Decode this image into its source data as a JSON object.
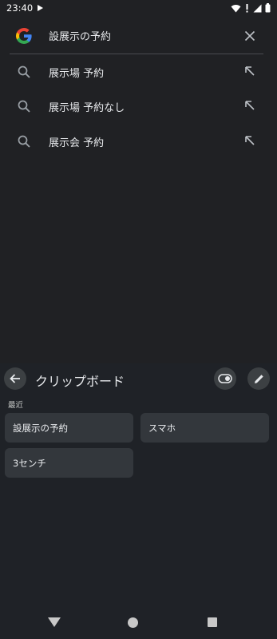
{
  "status_bar": {
    "time": "23:40"
  },
  "search": {
    "query": "設展示の予約",
    "suggestions": [
      {
        "text": "展示場 予約"
      },
      {
        "text": "展示場 予約なし"
      },
      {
        "text": "展示会 予約"
      }
    ]
  },
  "clipboard": {
    "title": "クリップボード",
    "section_label": "最近",
    "items": [
      {
        "text": "設展示の予約"
      },
      {
        "text": "スマホ"
      },
      {
        "text": "3センチ"
      }
    ]
  },
  "colors": {
    "background": "#202124",
    "keyboard_bg": "#1f2227",
    "chip_bg": "#33373c",
    "button_bg": "#3c4043",
    "text": "#e8eaed",
    "google_blue": "#4285F4",
    "google_red": "#EA4335",
    "google_yellow": "#FBBC05",
    "google_green": "#34A853"
  },
  "icons": {
    "status": [
      "play-icon",
      "wifi-icon",
      "silent-icon",
      "signal-icon",
      "battery-icon"
    ],
    "search": [
      "google-logo",
      "close-icon",
      "search-icon",
      "insert-arrow-icon"
    ],
    "clipboard": [
      "back-arrow-icon",
      "toggle-icon",
      "pencil-icon"
    ],
    "nav": [
      "nav-back-icon",
      "nav-home-icon",
      "nav-recents-icon"
    ]
  }
}
